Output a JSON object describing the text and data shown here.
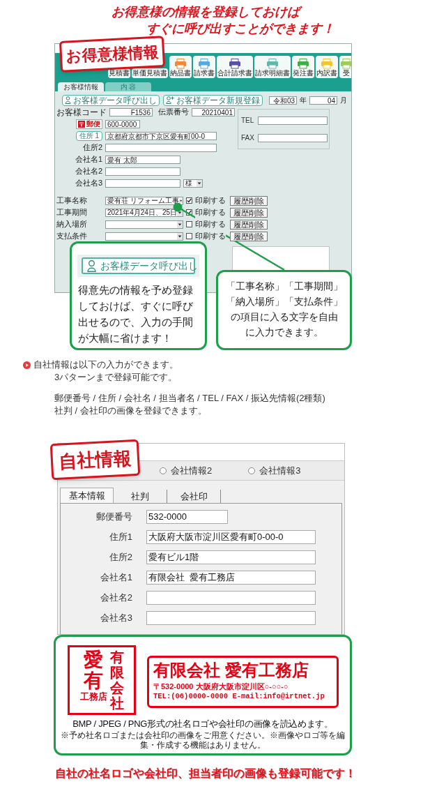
{
  "headline": [
    "お得意様の情報を登録しておけば",
    "すぐに呼び出すことができます！"
  ],
  "customer_window": {
    "badge": "お得意様情報",
    "toolbar": [
      {
        "label": "見積書",
        "kind": "text"
      },
      {
        "label": "単価見積書",
        "kind": "text"
      },
      {
        "label": "納品書",
        "kind": "printer",
        "color": "#f0883a"
      },
      {
        "label": "請求書",
        "kind": "printer",
        "color": "#5aa8e0"
      },
      {
        "label": "合計請求書",
        "kind": "printer",
        "color": "#5a4f9e"
      },
      {
        "label": "請求明細書",
        "kind": "printer",
        "color": "#5fb7ae"
      },
      {
        "label": "発注書",
        "kind": "printer",
        "color": "#3fae49"
      },
      {
        "label": "内訳書",
        "kind": "printer",
        "color": "#f2c531"
      },
      {
        "label": "受",
        "kind": "printer",
        "color": "#9ccc5a"
      }
    ],
    "tabs": [
      {
        "label": "お客様情報",
        "selected": true
      },
      {
        "label": "内 容",
        "selected": false
      }
    ],
    "actions": [
      {
        "label": "お客様データ呼び出し",
        "kind": "call"
      },
      {
        "label": "お客様データ新規登録",
        "kind": "new"
      }
    ],
    "date": {
      "era_year": "令和03",
      "year_unit": "年",
      "month": "04",
      "month_unit": "月"
    },
    "code": {
      "label": "お客様コード",
      "value": "F1536"
    },
    "slip": {
      "label": "伝票番号",
      "value": "20210401"
    },
    "contact": [
      {
        "label": "TEL"
      },
      {
        "label": "FAX"
      }
    ],
    "rows": [
      {
        "label": "郵便",
        "kind": "postal",
        "value": "600-0000"
      },
      {
        "label": "住所 1",
        "kind": "button",
        "value": "京都府京都市下京区愛有町00-0"
      },
      {
        "label": "住所2",
        "kind": "wide"
      },
      {
        "label": "会社名1",
        "kind": "name",
        "value": "愛有 太郎"
      },
      {
        "label": "会社名2",
        "kind": "name"
      },
      {
        "label": "会社名3",
        "kind": "name",
        "suffix": "様"
      }
    ],
    "combos": [
      {
        "label": "工事名称",
        "value": "愛有荘 リフォーム工事",
        "checked": true,
        "check_label": "印刷する",
        "button": "履歴削除"
      },
      {
        "label": "工事期間",
        "value": "2021年4月24日、25日",
        "checked": true,
        "check_label": "印刷する",
        "button": "履歴削除"
      },
      {
        "label": "納入場所",
        "checked": false,
        "check_label": "印刷する",
        "button": "履歴削除"
      },
      {
        "label": "支払条件",
        "checked": false,
        "check_label": "印刷する",
        "button": "履歴削除"
      }
    ]
  },
  "callouts": [
    {
      "button": "お客様データ呼び出し",
      "lines": [
        "得意先の情報を予め登録",
        "しておけば、すぐに呼び",
        "出せるので、入力の手間",
        "が大幅に省けます！"
      ]
    },
    {
      "lines": [
        "「工事名称」「工事期間」",
        "「納入場所」「支払条件」",
        "の項目に入る文字を自由",
        "に入力できます。"
      ]
    }
  ],
  "notice": {
    "lead": "自社情報は以下の入力ができます。",
    "lines": [
      "3パターンまで登録可能です。",
      "郵便番号 / 住所 / 会社名 / 担当者名 / TEL / FAX / 振込先情報(2種類)",
      "社判 / 会社印の画像を登録できます。"
    ]
  },
  "company_window": {
    "badge": "自社情報",
    "radios": [
      {
        "label": "会社情報2",
        "selected": false
      },
      {
        "label": "会社情報3",
        "selected": false
      }
    ],
    "tabs": [
      {
        "label": "基本情報",
        "selected": true
      },
      {
        "label": "社判",
        "selected": false
      },
      {
        "label": "会社印",
        "selected": false
      }
    ],
    "fields": [
      {
        "label": "郵便番号",
        "value": "532-0000",
        "kind": "short"
      },
      {
        "label": "住所1",
        "value": "大阪府大阪市淀川区愛有町0-00-0",
        "kind": "long"
      },
      {
        "label": "住所2",
        "value": "愛有ビル1階",
        "kind": "long"
      },
      {
        "label": "会社名1",
        "value": "有限会社  愛有工務店",
        "kind": "long"
      },
      {
        "label": "会社名2",
        "kind": "long"
      },
      {
        "label": "会社名3",
        "kind": "long"
      }
    ]
  },
  "logo_panel": {
    "seal": {
      "main": "愛有",
      "sub": "工務店",
      "side": "有限会社"
    },
    "logo": {
      "name": "有限会社 愛有工務店",
      "address": "〒532-0000 大阪府大阪市淀川区○-○○-○",
      "contact": "TEL:(06)0000-0000 E-mail:info@irtnet.jp"
    },
    "caption": "BMP / JPEG / PNG形式の社名ロゴや会社印の画像を読込めます。",
    "note": "※予め社名ロゴまたは会社印の画像をご用意ください。※画像やロゴ等を編集・作成する機能はありません。"
  },
  "footer": "自社の社名ロゴや会社印、担当者印の画像も登録可能です！"
}
